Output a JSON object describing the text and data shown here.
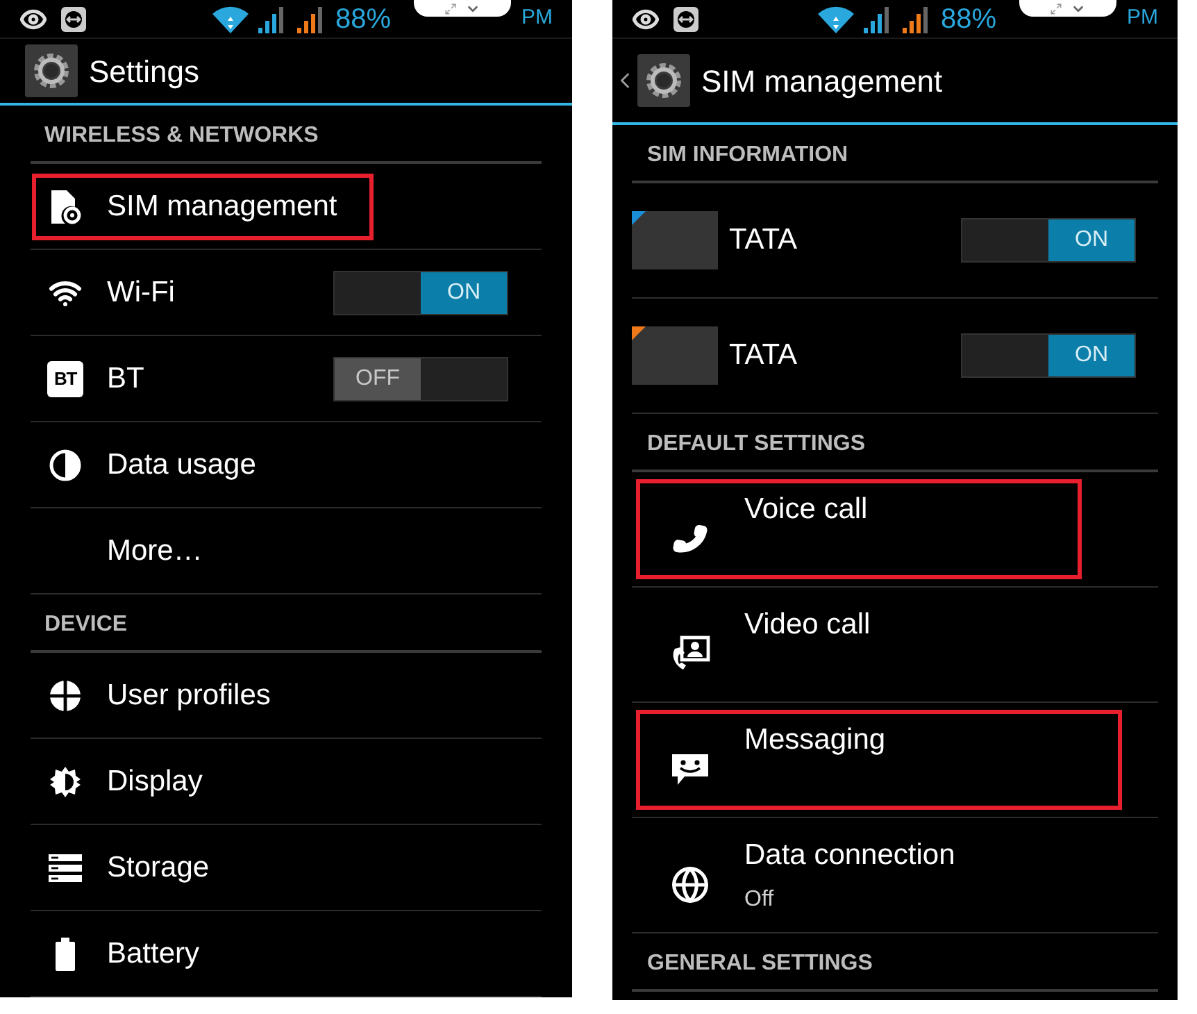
{
  "screens": [
    {
      "status_bar": {
        "battery": "88%",
        "period": "PM"
      },
      "header": {
        "title": "Settings",
        "back": false
      },
      "sections": [
        {
          "title": "WIRELESS & NETWORKS",
          "items": [
            {
              "kind": "link",
              "label": "SIM management",
              "highlighted": true
            },
            {
              "kind": "toggle",
              "label": "Wi-Fi",
              "on": true,
              "toggle_label": "ON",
              "highlighted": false
            },
            {
              "kind": "toggle",
              "label": "BT",
              "icon_text": "BT",
              "on": false,
              "toggle_label": "OFF",
              "highlighted": false
            },
            {
              "kind": "link",
              "label": "Data usage",
              "highlighted": false
            },
            {
              "kind": "link",
              "label": "More…",
              "highlighted": false
            }
          ]
        },
        {
          "title": "DEVICE",
          "items": [
            {
              "kind": "link",
              "label": "User profiles",
              "highlighted": false
            },
            {
              "kind": "link",
              "label": "Display",
              "highlighted": false
            },
            {
              "kind": "link",
              "label": "Storage",
              "highlighted": false
            },
            {
              "kind": "link",
              "label": "Battery",
              "highlighted": false
            }
          ]
        }
      ]
    },
    {
      "status_bar": {
        "battery": "88%",
        "period": "PM"
      },
      "header": {
        "title": "SIM management",
        "back": true
      },
      "sections": [
        {
          "title": "SIM INFORMATION",
          "items": [
            {
              "kind": "sim",
              "label": "TATA",
              "color": "#1a8fd8",
              "on": true,
              "toggle_label": "ON"
            },
            {
              "kind": "sim",
              "label": "TATA",
              "color": "#f07a1a",
              "on": true,
              "toggle_label": "ON"
            }
          ]
        },
        {
          "title": "DEFAULT SETTINGS",
          "items": [
            {
              "kind": "detail",
              "label": "Voice call",
              "highlighted": true
            },
            {
              "kind": "detail",
              "label": "Video call",
              "highlighted": false
            },
            {
              "kind": "detail",
              "label": "Messaging",
              "highlighted": true
            },
            {
              "kind": "detail",
              "label": "Data connection",
              "summary": "Off",
              "highlighted": false
            }
          ]
        },
        {
          "title": "GENERAL SETTINGS"
        }
      ]
    }
  ]
}
